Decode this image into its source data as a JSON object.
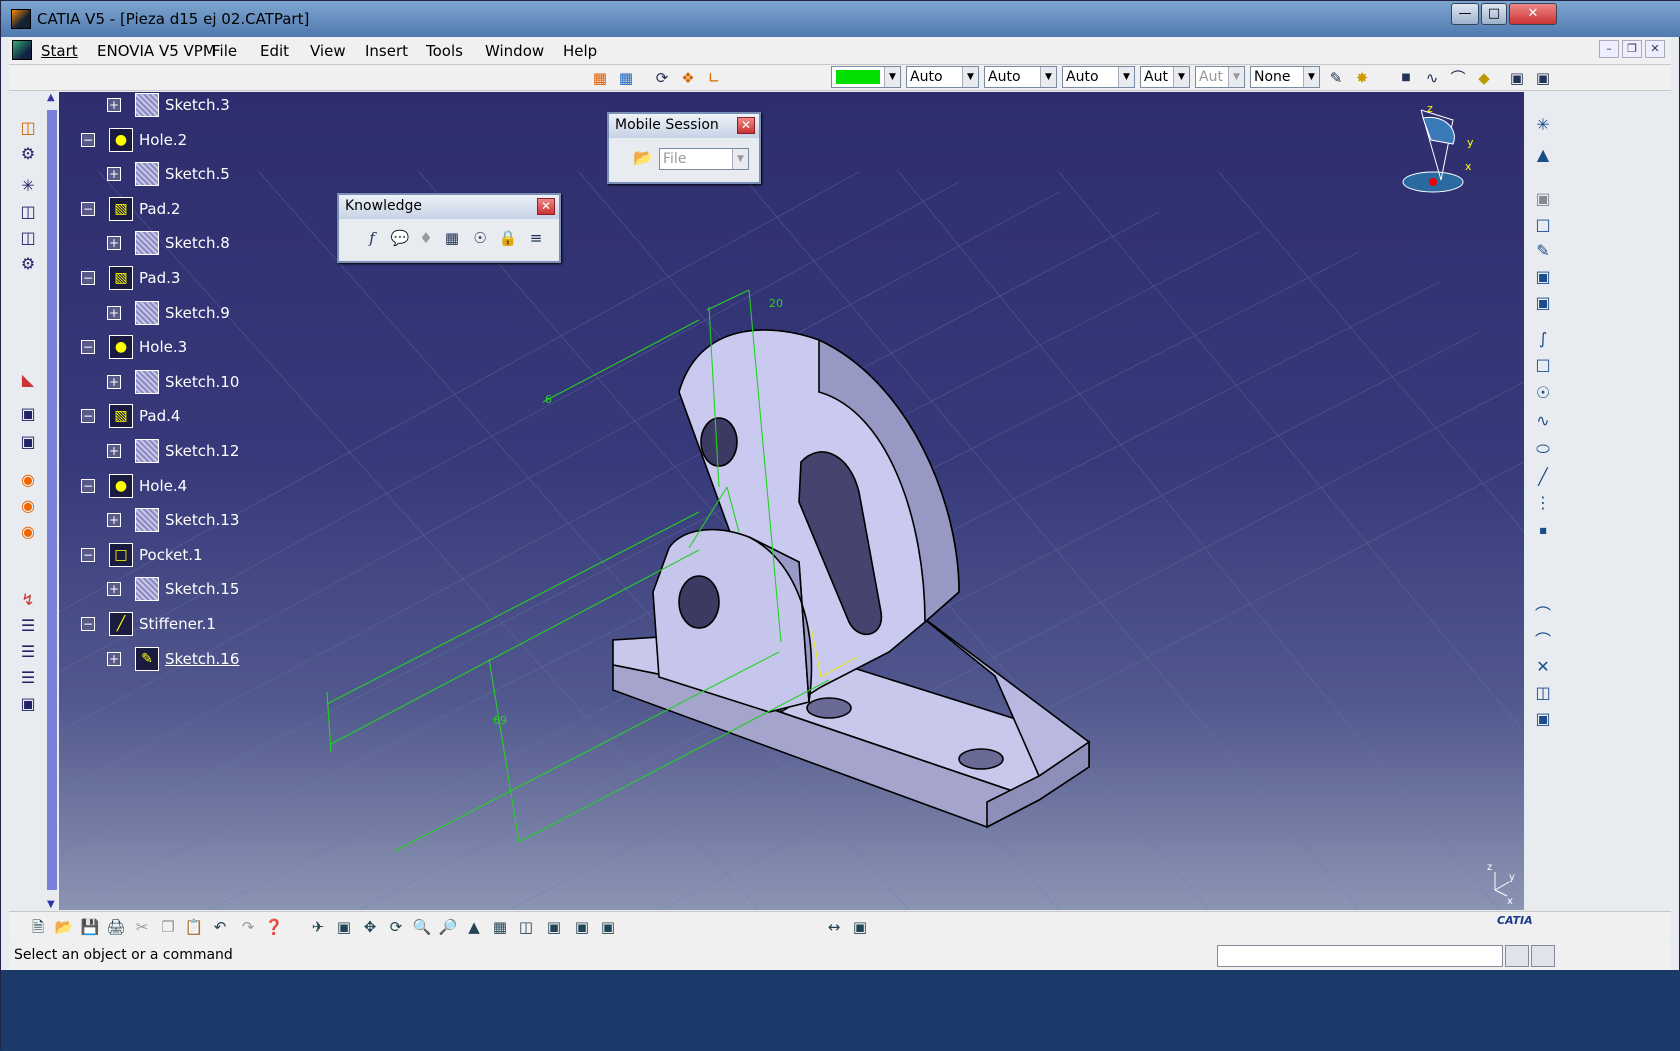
{
  "window": {
    "title": "CATIA V5 - [Pieza d15 ej 02.CATPart]"
  },
  "menu": {
    "items": [
      "Start",
      "ENOVIA V5 VPM",
      "File",
      "Edit",
      "View",
      "Insert",
      "Tools",
      "Window",
      "Help"
    ]
  },
  "graphic_props": {
    "color": "#00e000",
    "transparency": "Auto",
    "linetype": "Auto",
    "thickness": "Auto",
    "point": "Aut",
    "layer_disabled": "Aut",
    "layer": "None"
  },
  "tree": [
    {
      "label": "Sketch.3",
      "type": "sketch"
    },
    {
      "label": "Hole.2",
      "type": "hole"
    },
    {
      "label": "Sketch.5",
      "type": "sketch"
    },
    {
      "label": "Pad.2",
      "type": "pad"
    },
    {
      "label": "Sketch.8",
      "type": "sketch"
    },
    {
      "label": "Pad.3",
      "type": "pad"
    },
    {
      "label": "Sketch.9",
      "type": "sketch"
    },
    {
      "label": "Hole.3",
      "type": "hole"
    },
    {
      "label": "Sketch.10",
      "type": "sketch"
    },
    {
      "label": "Pad.4",
      "type": "pad"
    },
    {
      "label": "Sketch.12",
      "type": "sketch"
    },
    {
      "label": "Hole.4",
      "type": "hole"
    },
    {
      "label": "Sketch.13",
      "type": "sketch"
    },
    {
      "label": "Pocket.1",
      "type": "pocket"
    },
    {
      "label": "Sketch.15",
      "type": "sketch"
    },
    {
      "label": "Stiffener.1",
      "type": "stiffener"
    },
    {
      "label": "Sketch.16",
      "type": "sketch-active"
    }
  ],
  "mobile_session": {
    "title": "Mobile Session",
    "file_combo": "File"
  },
  "knowledge": {
    "title": "Knowledge"
  },
  "dimensions": {
    "d20": "20",
    "d6": "6",
    "d69": "69"
  },
  "compass": {
    "z": "z",
    "y": "y",
    "x": "x"
  },
  "mini_axis": {
    "z": "z",
    "y": "y",
    "x": "x"
  },
  "status": {
    "message": "Select an object or a command"
  },
  "brand": "CATIA"
}
